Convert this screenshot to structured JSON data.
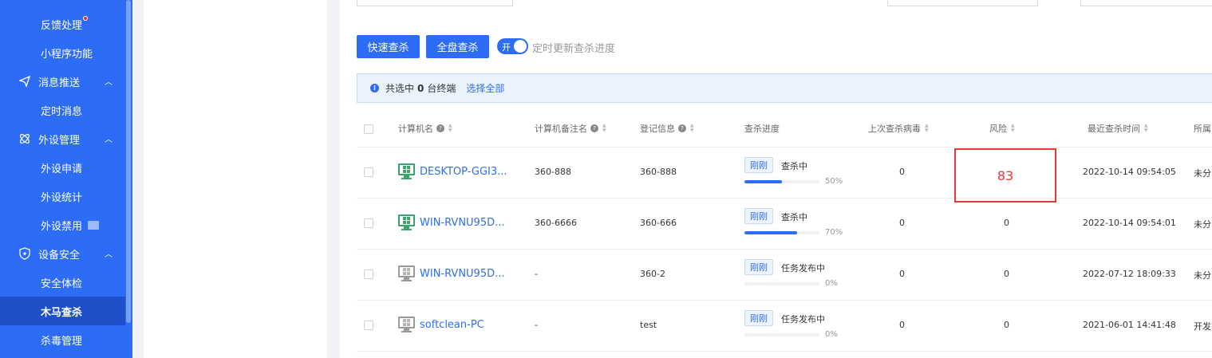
{
  "colors": {
    "accent": "#2d6df5",
    "risk": "#e53935"
  },
  "sidebar": {
    "items": [
      {
        "label": "反馈处理",
        "type": "sub",
        "has_dot": true
      },
      {
        "label": "小程序功能",
        "type": "sub"
      },
      {
        "label": "消息推送",
        "type": "group",
        "icon": "send-icon",
        "chevron": "up"
      },
      {
        "label": "定时消息",
        "type": "sub"
      },
      {
        "label": "外设管理",
        "type": "group",
        "icon": "peripheral-icon",
        "chevron": "up"
      },
      {
        "label": "外设申请",
        "type": "sub"
      },
      {
        "label": "外设统计",
        "type": "sub"
      },
      {
        "label": "外设禁用",
        "type": "sub",
        "icon": "image-badge-icon"
      },
      {
        "label": "设备安全",
        "type": "group",
        "icon": "shield-icon",
        "chevron": "up"
      },
      {
        "label": "安全体检",
        "type": "sub"
      },
      {
        "label": "木马查杀",
        "type": "sub",
        "active": true
      },
      {
        "label": "杀毒管理",
        "type": "sub"
      }
    ]
  },
  "toolbar": {
    "quick_scan": "快速查杀",
    "full_scan": "全盘查杀",
    "toggle_label": "开",
    "toggle_on": true,
    "toggle_text": "定时更新查杀进度"
  },
  "selection": {
    "prefix": "共选中",
    "count": "0",
    "suffix": "台终端",
    "select_all": "选择全部"
  },
  "table": {
    "columns": [
      "计算机名",
      "计算机备注名",
      "登记信息",
      "查杀进度",
      "上次查杀病毒",
      "风险",
      "最近查杀时间",
      "所属"
    ],
    "rows": [
      {
        "name": "DESKTOP-GGI3...",
        "remark": "360-888",
        "reg": "360-888",
        "tag": "刚刚",
        "status": "查杀中",
        "progress": 50,
        "progress_label": "50%",
        "viruses": "0",
        "risk": "83",
        "time": "2022-10-14 09:54:05",
        "group": "未分",
        "online": true
      },
      {
        "name": "WIN-RVNU95D...",
        "remark": "360-6666",
        "reg": "360-666",
        "tag": "刚刚",
        "status": "查杀中",
        "progress": 70,
        "progress_label": "70%",
        "viruses": "0",
        "risk": "0",
        "time": "2022-10-14 09:54:01",
        "group": "未分",
        "online": true
      },
      {
        "name": "WIN-RVNU95D...",
        "remark": "-",
        "reg": "360-2",
        "tag": "刚刚",
        "status": "任务发布中",
        "progress": 0,
        "progress_label": "0%",
        "viruses": "0",
        "risk": "0",
        "time": "2022-07-12 18:09:33",
        "group": "未分",
        "online": false
      },
      {
        "name": "softclean-PC",
        "remark": "-",
        "reg": "test",
        "tag": "刚刚",
        "status": "任务发布中",
        "progress": 0,
        "progress_label": "0%",
        "viruses": "0",
        "risk": "0",
        "time": "2021-06-01 14:41:48",
        "group": "开发",
        "online": false
      }
    ]
  }
}
